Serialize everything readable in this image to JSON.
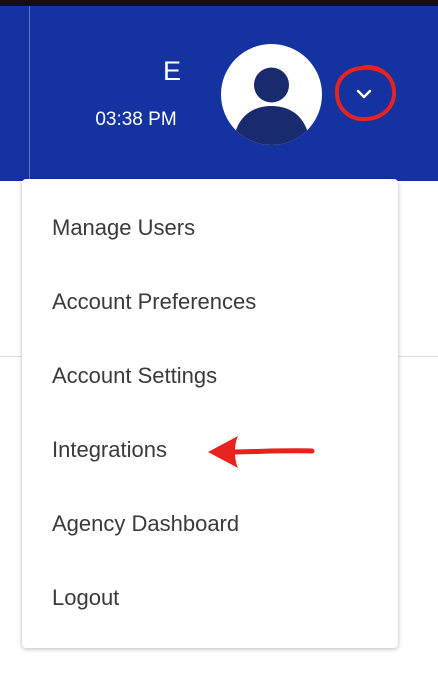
{
  "header": {
    "user_initial": "E",
    "time": "03:38 PM",
    "background_color": "#1433a0"
  },
  "avatar": {
    "icon": "user-silhouette-icon"
  },
  "dropdown_toggle": {
    "icon": "chevron-down-icon",
    "highlighted": true
  },
  "menu": {
    "items": [
      {
        "label": "Manage Users"
      },
      {
        "label": "Account Preferences"
      },
      {
        "label": "Account Settings"
      },
      {
        "label": "Integrations"
      },
      {
        "label": "Agency Dashboard"
      },
      {
        "label": "Logout"
      }
    ]
  },
  "annotations": {
    "circle_color": "#e8221c",
    "arrow_color": "#e8221c",
    "arrow_points_to": "Integrations"
  }
}
